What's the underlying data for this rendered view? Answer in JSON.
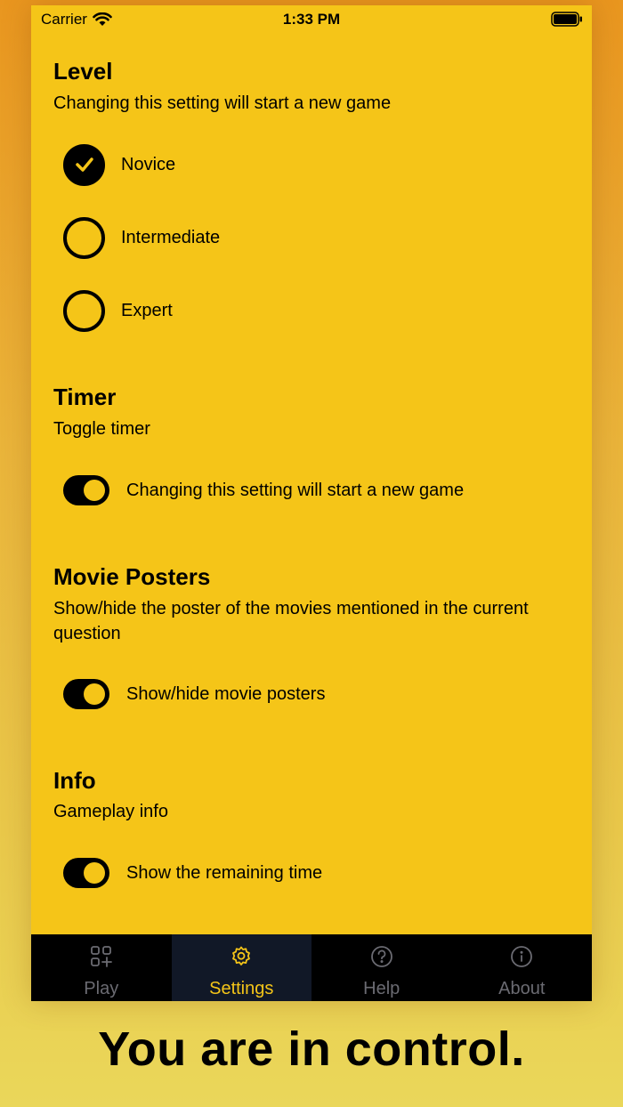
{
  "status": {
    "carrier": "Carrier",
    "time": "1:33 PM"
  },
  "level": {
    "title": "Level",
    "subtitle": "Changing this setting will start a new game",
    "options": [
      {
        "label": "Novice",
        "checked": true
      },
      {
        "label": "Intermediate",
        "checked": false
      },
      {
        "label": "Expert",
        "checked": false
      }
    ]
  },
  "timer": {
    "title": "Timer",
    "subtitle": "Toggle timer",
    "toggle_label": "Changing this setting will start a new game",
    "on": true
  },
  "posters": {
    "title": "Movie Posters",
    "subtitle": "Show/hide the poster of the movies mentioned in the current question",
    "toggle_label": "Show/hide movie posters",
    "on": true
  },
  "info": {
    "title": "Info",
    "subtitle": "Gameplay info",
    "toggle_label": "Show the remaining time",
    "on": true
  },
  "tabs": [
    {
      "label": "Play",
      "icon": "grid-plus-icon",
      "active": false
    },
    {
      "label": "Settings",
      "icon": "gear-icon",
      "active": true
    },
    {
      "label": "Help",
      "icon": "question-circle-icon",
      "active": false
    },
    {
      "label": "About",
      "icon": "info-circle-icon",
      "active": false
    }
  ],
  "tagline": "You are in control.",
  "colors": {
    "accent": "#f5c518",
    "tabbar": "#000000",
    "active_tab": "#111827",
    "inactive_tab": "#6b6b72"
  }
}
